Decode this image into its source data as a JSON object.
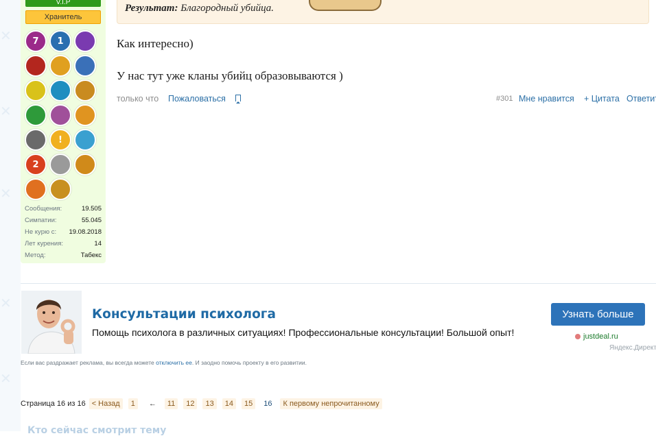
{
  "user": {
    "vip_label": "V.I.P",
    "role": "Хранитель",
    "awards": [
      {
        "icon": "black-car-award-icon",
        "color": "#9b2a8a",
        "badge": "7"
      },
      {
        "icon": "number-one-award-icon",
        "color": "#2a6fb0",
        "badge": "1"
      },
      {
        "icon": "dancers-award-icon",
        "color": "#7a3ab0",
        "badge": ""
      },
      {
        "icon": "red-badge-award-icon",
        "color": "#b3261e",
        "badge": ""
      },
      {
        "icon": "house-award-icon",
        "color": "#e0a020",
        "badge": ""
      },
      {
        "icon": "rocket-award-icon",
        "color": "#3a70b8",
        "badge": ""
      },
      {
        "icon": "yellow-check-award-icon",
        "color": "#d9c21a",
        "badge": ""
      },
      {
        "icon": "runners-award-icon",
        "color": "#1f8ec0",
        "badge": ""
      },
      {
        "icon": "stars-award-icon",
        "color": "#c98b20",
        "badge": ""
      },
      {
        "icon": "health-award-icon",
        "color": "#2e9a3a",
        "badge": ""
      },
      {
        "icon": "profile-award-icon",
        "color": "#a0509a",
        "badge": ""
      },
      {
        "icon": "camera-award-icon",
        "color": "#e09420",
        "badge": ""
      },
      {
        "icon": "aperture-award-icon",
        "color": "#6a6a6a",
        "badge": ""
      },
      {
        "icon": "exclamation-award-icon",
        "color": "#f0b020",
        "badge": "!"
      },
      {
        "icon": "quill-award-icon",
        "color": "#3aa0d0",
        "badge": ""
      },
      {
        "icon": "tomato-award-icon",
        "color": "#d8401e",
        "badge": "2"
      },
      {
        "icon": "wings-award-icon",
        "color": "#9a9a9a",
        "badge": ""
      },
      {
        "icon": "gold-aperture-award-icon",
        "color": "#d08a1a",
        "badge": ""
      },
      {
        "icon": "books-award-icon",
        "color": "#e07020",
        "badge": ""
      },
      {
        "icon": "athlete-award-icon",
        "color": "#c89020",
        "badge": ""
      }
    ],
    "stats": [
      {
        "label": "Сообщения:",
        "value": "19.505"
      },
      {
        "label": "Симпатии:",
        "value": "55.045"
      },
      {
        "label": "Не курю с:",
        "value": "19.08.2018"
      },
      {
        "label": "Лет курения:",
        "value": "14"
      },
      {
        "label": "Метод:",
        "value": "Табекс"
      }
    ]
  },
  "quote": {
    "label": "Результат:",
    "text": "Благородный убийца."
  },
  "post": {
    "line1": "Как интересно)",
    "line2": "У нас тут уже кланы убийц образовываются )",
    "time": "только что",
    "report": "Пожаловаться",
    "number": "#301",
    "like": "Мне нравится",
    "quote": "+ Цитата",
    "reply": "Ответить"
  },
  "ad": {
    "title": "Консультации психолога",
    "text": "Помощь психолога в различных ситуациях! Профессиональные консультации! Большой опыт!",
    "button": "Узнать больше",
    "domain": "justdeal.ru",
    "source": "Яндекс.Директ",
    "note_before": "Если вас раздражает реклама, вы всегда можете ",
    "note_link": "отключить ее",
    "note_after": ". И заодно помочь проекту в его развитии."
  },
  "pagination": {
    "label": "Страница 16 из 16",
    "prev": "< Назад",
    "first_page": "1",
    "gap": "←",
    "pages": [
      "11",
      "12",
      "13",
      "14",
      "15"
    ],
    "current": "16",
    "first_unread": "К первому непрочитанному"
  },
  "next_section_title": "Кто сейчас смотрит тему"
}
